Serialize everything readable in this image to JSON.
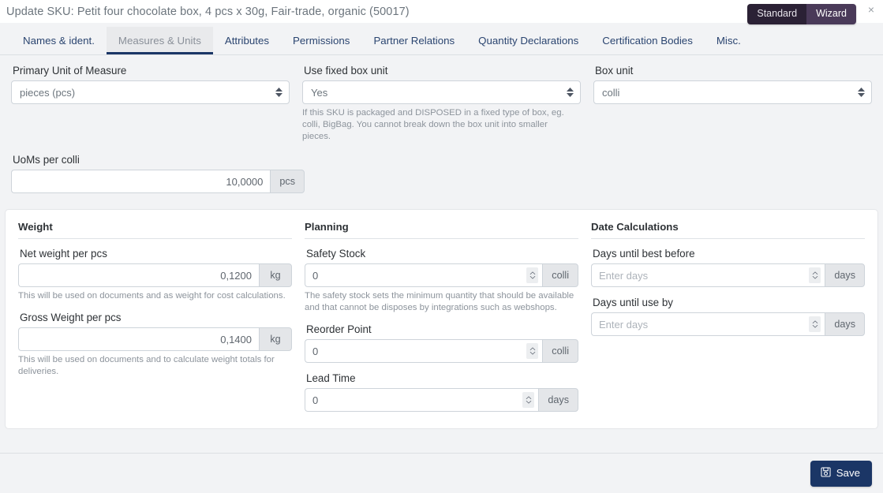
{
  "window": {
    "title": "Update SKU: Petit four chocolate box, 4 pcs x 30g, Fair-trade, organic (50017)",
    "close_label": "×",
    "mode_toggle": {
      "standard_label": "Standard",
      "wizard_label": "Wizard",
      "active": "Wizard"
    }
  },
  "tabs": [
    {
      "label": "Names & ident.",
      "active": false
    },
    {
      "label": "Measures & Units",
      "active": true
    },
    {
      "label": "Attributes",
      "active": false
    },
    {
      "label": "Permissions",
      "active": false
    },
    {
      "label": "Partner Relations",
      "active": false
    },
    {
      "label": "Quantity Declarations",
      "active": false
    },
    {
      "label": "Certification Bodies",
      "active": false
    },
    {
      "label": "Misc.",
      "active": false
    }
  ],
  "top_row": {
    "primary_uom": {
      "label": "Primary Unit of Measure",
      "value": "pieces (pcs)"
    },
    "fixed_box_unit": {
      "label": "Use fixed box unit",
      "value": "Yes",
      "help": "If this SKU is packaged and DISPOSED in a fixed type of box, eg. colli, BigBag. You cannot break down the box unit into smaller pieces."
    },
    "box_unit": {
      "label": "Box unit",
      "value": "colli"
    }
  },
  "uoms_per_colli": {
    "label": "UoMs per colli",
    "value": "10,0000",
    "unit": "pcs"
  },
  "weight": {
    "heading": "Weight",
    "net": {
      "label": "Net weight per pcs",
      "value": "0,1200",
      "unit": "kg",
      "help": "This will be used on documents and as weight for cost calculations."
    },
    "gross": {
      "label": "Gross Weight per pcs",
      "value": "0,1400",
      "unit": "kg",
      "help": "This will be used on documents and to calculate weight totals for deliveries."
    }
  },
  "planning": {
    "heading": "Planning",
    "safety_stock": {
      "label": "Safety Stock",
      "value": "0",
      "unit": "colli",
      "help": "The safety stock sets the minimum quantity that should be available and that cannot be disposes by integrations such as webshops."
    },
    "reorder_point": {
      "label": "Reorder Point",
      "value": "0",
      "unit": "colli"
    },
    "lead_time": {
      "label": "Lead Time",
      "value": "0",
      "unit": "days"
    }
  },
  "date_calculations": {
    "heading": "Date Calculations",
    "best_before": {
      "label": "Days until best before",
      "placeholder": "Enter days",
      "value": "",
      "unit": "days"
    },
    "use_by": {
      "label": "Days until use by",
      "placeholder": "Enter days",
      "value": "",
      "unit": "days"
    }
  },
  "footer": {
    "save_label": "Save"
  },
  "colors": {
    "accent": "#1b3666",
    "wizard_active": "#4a3a59",
    "standard": "#2b2135",
    "page_bg": "#f2f3f5"
  }
}
